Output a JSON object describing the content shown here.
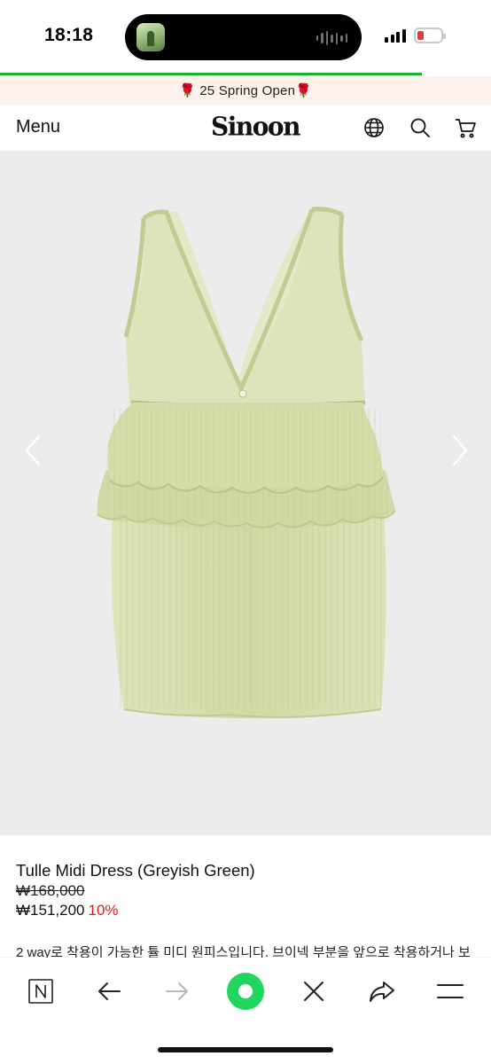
{
  "status_bar": {
    "time": "18:18",
    "battery_color": "#e53935",
    "page_load_progress": 0.86
  },
  "banner": {
    "text": "🌹 25 Spring Open🌹"
  },
  "header": {
    "menu_label": "Menu",
    "logo_text": "Sinoon",
    "icons": [
      "globe-icon",
      "search-icon",
      "cart-icon"
    ]
  },
  "product": {
    "image_icon": "dress-photo",
    "gallery_arrows": [
      "chevron-left-icon",
      "chevron-right-icon"
    ],
    "name": "Tulle Midi Dress (Greyish Green)",
    "original_price": "₩168,000",
    "sale_price": "₩151,200",
    "discount": "10%",
    "description": "2 way로 착용이 가능한 튤 미디 원피스입니다. 브이넥 부분을 앞으로 착용하거나 보",
    "colors": {
      "dress": "#d4dba8",
      "discount": "#e02020"
    }
  },
  "browser_toolbar": {
    "buttons": [
      "naver-icon",
      "back-arrow-icon",
      "forward-arrow-icon",
      "green-dot-icon",
      "close-icon",
      "share-icon",
      "menu-icon"
    ],
    "accent": "#1ed760"
  }
}
